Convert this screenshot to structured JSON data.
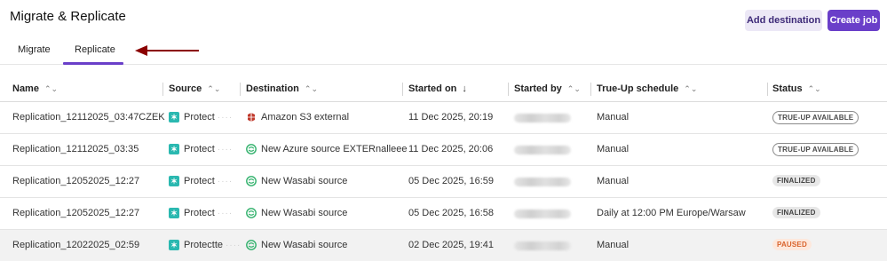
{
  "header": {
    "title": "Migrate & Replicate",
    "add_destination_label": "Add destination",
    "create_job_label": "Create job"
  },
  "tabs": [
    {
      "label": "Migrate",
      "active": false
    },
    {
      "label": "Replicate",
      "active": true
    }
  ],
  "colors": {
    "accent": "#6a3fc9",
    "arrow": "#8b0000",
    "protect_icon": "#2ab8b0",
    "azure_icon": "#2fb06a",
    "s3_icon": "#c0392b"
  },
  "table": {
    "columns": [
      {
        "label": "Name",
        "sort_icon": "sort-updown-icon"
      },
      {
        "label": "Source",
        "sort_icon": "sort-updown-icon"
      },
      {
        "label": "Destination",
        "sort_icon": "sort-updown-icon"
      },
      {
        "label": "Started on",
        "sort_icon": "sort-down-arrow-icon"
      },
      {
        "label": "Started by",
        "sort_icon": "sort-updown-icon"
      },
      {
        "label": "True-Up schedule",
        "sort_icon": "sort-updown-icon"
      },
      {
        "label": "Status",
        "sort_icon": "sort-updown-icon"
      }
    ],
    "rows": [
      {
        "name": "Replication_12112025_03:47CZEK",
        "source": "Protect",
        "destination": "Amazon S3 external",
        "dest_icon": "s3-icon",
        "started_on": "11 Dec 2025, 20:19",
        "schedule": "Manual",
        "status": "TRUE-UP AVAILABLE",
        "status_style": "outline",
        "highlight": false
      },
      {
        "name": "Replication_12112025_03:35",
        "source": "Protect",
        "destination": "New Azure source EXTERnalleee",
        "dest_icon": "cloud-sync-icon",
        "started_on": "11 Dec 2025, 20:06",
        "schedule": "Manual",
        "status": "TRUE-UP AVAILABLE",
        "status_style": "outline",
        "highlight": false
      },
      {
        "name": "Replication_12052025_12:27",
        "source": "Protect",
        "destination": "New Wasabi source",
        "dest_icon": "cloud-sync-icon",
        "started_on": "05 Dec 2025, 16:59",
        "schedule": "Manual",
        "status": "FINALIZED",
        "status_style": "gray",
        "highlight": false
      },
      {
        "name": "Replication_12052025_12:27",
        "source": "Protect",
        "destination": "New Wasabi source",
        "dest_icon": "cloud-sync-icon",
        "started_on": "05 Dec 2025, 16:58",
        "schedule": "Daily at 12:00 PM Europe/Warsaw",
        "status": "FINALIZED",
        "status_style": "gray",
        "highlight": false
      },
      {
        "name": "Replication_12022025_02:59",
        "source": "Protectte",
        "destination": "New Wasabi source",
        "dest_icon": "cloud-sync-icon",
        "started_on": "02 Dec 2025, 19:41",
        "schedule": "Manual",
        "status": "PAUSED",
        "status_style": "orange",
        "highlight": true
      }
    ]
  }
}
